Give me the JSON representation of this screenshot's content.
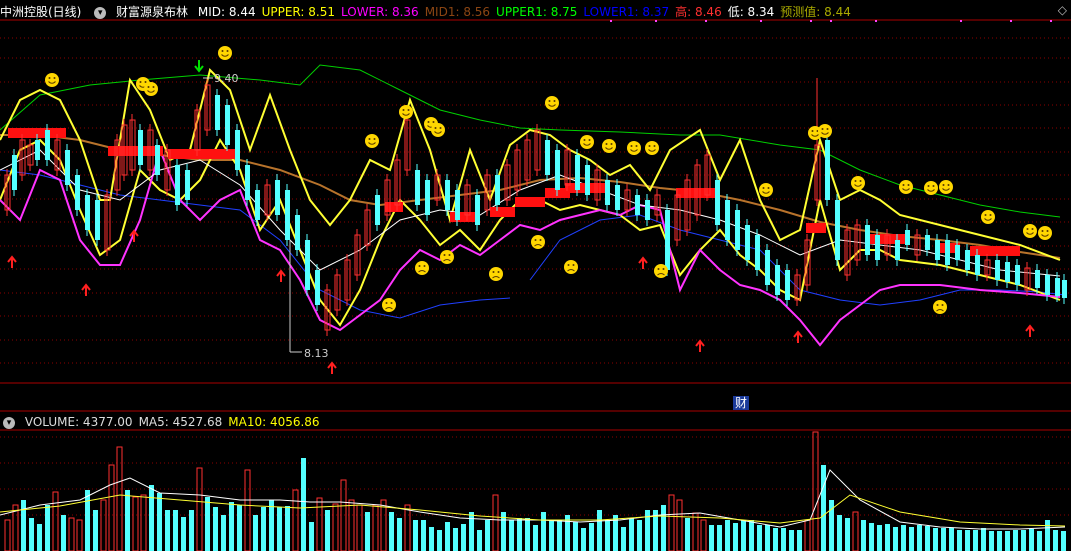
{
  "header": {
    "symbol": "中洲控股(日线)",
    "indicator_name": "财富源泉布林",
    "fields": [
      {
        "label": "MID: 8.44",
        "color": "#ffffff"
      },
      {
        "label": "UPPER: 8.51",
        "color": "#ffff00"
      },
      {
        "label": "LOWER: 8.36",
        "color": "#ff00ff"
      },
      {
        "label": "MID1: 8.56",
        "color": "#8b4513"
      },
      {
        "label": "UPPER1: 8.75",
        "color": "#00ff00"
      },
      {
        "label": "LOWER1: 8.37",
        "color": "#0000ff"
      },
      {
        "label": "高: 8.46",
        "color": "#ff3030"
      },
      {
        "label": "低: 8.34",
        "color": "#ffffff"
      },
      {
        "label": "预测值: 8.44",
        "color": "#aaaa00"
      }
    ]
  },
  "volume_header": {
    "fields": [
      {
        "label": "VOLUME: 4377.00",
        "color": "#dddddd"
      },
      {
        "label": "MA5: 4527.68",
        "color": "#dddddd"
      },
      {
        "label": "MA10: 4056.86",
        "color": "#ffff00"
      }
    ]
  },
  "annotations": {
    "high_price": "9.40",
    "low_price": "8.13",
    "financial_marker": "财",
    "diamond": "◇"
  },
  "colors": {
    "background": "#000000",
    "up_candle": "#ff3030",
    "down_candle": "#54ffff",
    "grid": "#8b0000"
  }
}
